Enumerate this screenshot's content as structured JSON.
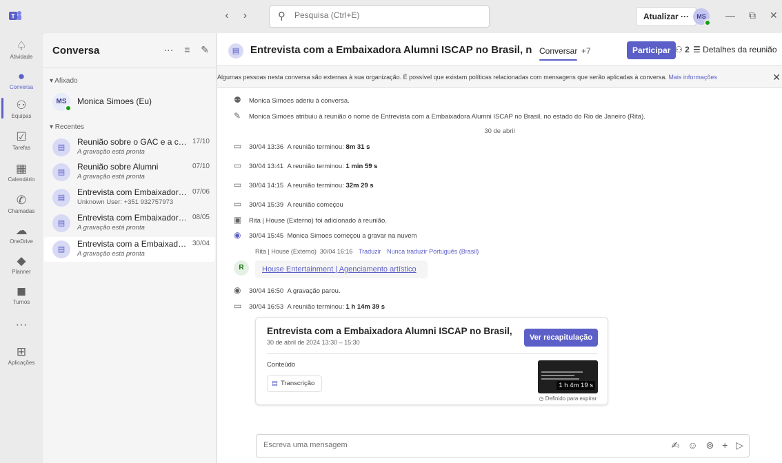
{
  "titlebar": {
    "search_placeholder": "Pesquisa (Ctrl+E)",
    "update_label": "Atualizar ···",
    "avatar_initials": "MS",
    "back_arrow": "‹",
    "forward_arrow": "›",
    "minimize": "—",
    "maximize": "⧉",
    "close": "✕"
  },
  "rail": {
    "items": [
      {
        "icon": "bell-icon",
        "glyph": "🔔︎",
        "label": "Atividade"
      },
      {
        "icon": "chat-icon",
        "glyph": "💬︎",
        "label": "Conversa"
      },
      {
        "icon": "teams-icon",
        "glyph": "⚇",
        "label": "Equipas"
      },
      {
        "icon": "tasks-icon",
        "glyph": "☑",
        "label": "Tarefas"
      },
      {
        "icon": "calendar-icon",
        "glyph": "▦",
        "label": "Calendário"
      },
      {
        "icon": "phone-icon",
        "glyph": "✆",
        "label": "Chamadas"
      },
      {
        "icon": "cloud-icon",
        "glyph": "☁",
        "label": "OneDrive"
      },
      {
        "icon": "planner-icon",
        "glyph": "◆",
        "label": "Planner"
      },
      {
        "icon": "shifts-icon",
        "glyph": "◼",
        "label": "Turnos"
      },
      {
        "icon": "more-icon",
        "glyph": "···",
        "label": ""
      },
      {
        "icon": "apps-icon",
        "glyph": "⊞",
        "label": "Aplicações"
      }
    ],
    "active_color": "#5b5fc7"
  },
  "list": {
    "title": "Conversa",
    "more": "···",
    "filter": "≡",
    "compose": "✎",
    "pinned_header": "▾ Afixado",
    "recent_header": "▾ Recentes",
    "pinned": [
      {
        "initials": "MS",
        "name": "Monica Simoes (Eu)"
      }
    ],
    "recent": [
      {
        "name": "Reunião sobre o GAC e a com...",
        "sub": "A gravação está pronta",
        "date": "17/10"
      },
      {
        "name": "Reunião sobre Alumni",
        "sub": "A gravação está pronta",
        "date": "07/10"
      },
      {
        "name": "Entrevista com Embaixadora ...",
        "sub": "Unknown User: +351 932757973",
        "date": "07/06"
      },
      {
        "name": "Entrevista com Embaixadora ...",
        "sub": "A gravação está pronta",
        "date": "08/05"
      },
      {
        "name": "Entrevista com a Embaixadora...",
        "sub": "A gravação está pronta",
        "date": "30/04"
      }
    ]
  },
  "main": {
    "title": "Entrevista com a Embaixadora Alumni ISCAP no Brasil, no e...",
    "tab": "Conversar",
    "more_tabs": "+7",
    "join_label": "Participar",
    "participants": "2",
    "details_label": "Detalhes da reunião",
    "banner_text": "Algumas pessoas nesta conversa são externas à sua organização. É possível que existam políticas relacionadas com mensagens que serão aplicadas à conversa.",
    "banner_link": "Mais informações",
    "events_top": [
      {
        "icon": "person-add-icon",
        "glyph": "⚉",
        "text": "Monica Simoes aderiu à conversa."
      },
      {
        "icon": "pencil-icon",
        "glyph": "✎",
        "text": "Monica Simoes atribuiu à reunião o nome de Entrevista com a Embaixadora Alumni ISCAP no Brasil, no estado do Rio de Janeiro (Rita)."
      }
    ],
    "date_divider": "30 de abril",
    "events": [
      {
        "icon": "video-icon",
        "glyph": "▭",
        "time": "30/04 13:36",
        "text": "A reunião terminou:",
        "bold": "8m 31 s"
      },
      {
        "icon": "video-icon",
        "glyph": "▭",
        "time": "30/04 13:41",
        "text": "A reunião terminou:",
        "bold": "1 min 59 s"
      },
      {
        "icon": "video-icon",
        "glyph": "▭",
        "time": "30/04 14:15",
        "text": "A reunião terminou:",
        "bold": "32m 29 s"
      },
      {
        "icon": "video-icon",
        "glyph": "▭",
        "time": "30/04 15:39",
        "text": "A reunião começou",
        "bold": ""
      },
      {
        "icon": "calendar-add-icon",
        "glyph": "▣",
        "time": "",
        "text": "Rita | House (Externo) foi adicionado à reunião.",
        "bold": ""
      },
      {
        "icon": "record-icon",
        "glyph": "◉",
        "time": "30/04 15:45",
        "text": "Monica Simoes começou a gravar na nuvem",
        "bold": ""
      }
    ],
    "message": {
      "author": "Rita | House (Externo)",
      "time": "30/04 16:16",
      "translate": "Traduzir",
      "never_translate": "Nunca traduzir Português (Brasil)",
      "avatar": "R",
      "link_text": "House Entertainment | Agenciamento artístico"
    },
    "events_after": [
      {
        "icon": "stop-record-icon",
        "glyph": "◉",
        "time": "30/04 16:50",
        "text": "A gravação parou.",
        "bold": ""
      },
      {
        "icon": "video-icon",
        "glyph": "▭",
        "time": "30/04 16:53",
        "text": "A reunião terminou:",
        "bold": "1 h 14m 39 s"
      }
    ],
    "recap": {
      "title": "Entrevista com a Embaixadora Alumni ISCAP no Brasil, no est...",
      "subtitle": "30 de abril de 2024 13:30 – 15:30",
      "button": "Ver recapitulação",
      "content_label": "Conteúdo",
      "transcript_label": "Transcrição",
      "duration": "1 h 4m 19 s",
      "expire_label": "Definido para expirar"
    },
    "composer_placeholder": "Escreva uma mensagem"
  }
}
